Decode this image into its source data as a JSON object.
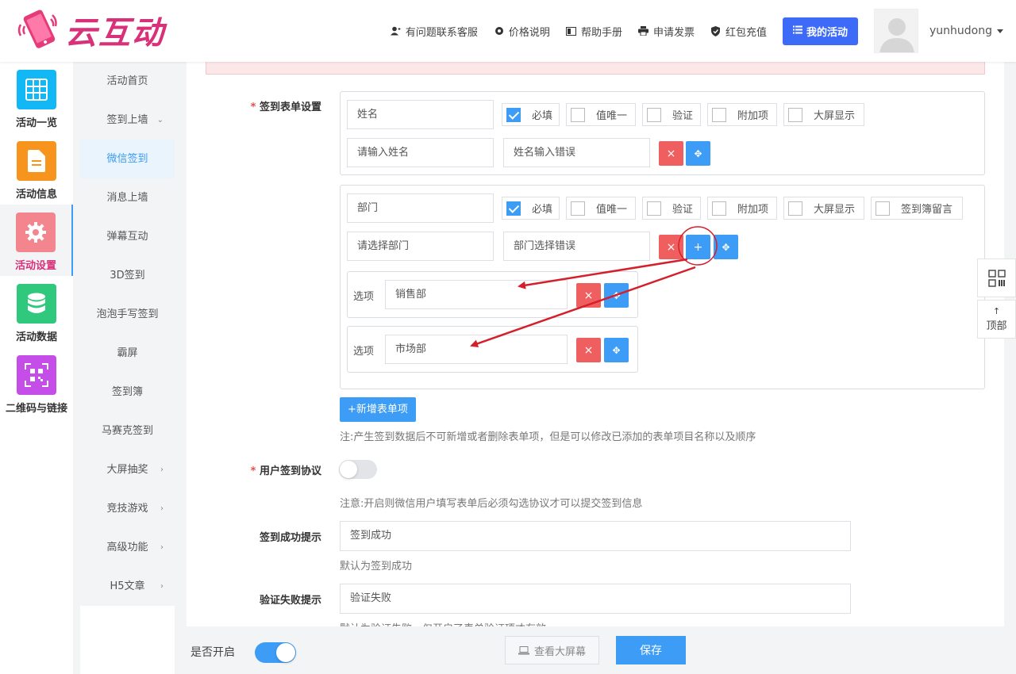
{
  "brand": {
    "name": "云互动",
    "color": "#d9307a"
  },
  "nav": {
    "support": "有问题联系客服",
    "pricing": "价格说明",
    "manual": "帮助手册",
    "invoice": "申请发票",
    "redpack": "红包充值",
    "my_activity": "我的活动",
    "username": "yunhudong"
  },
  "icon_sidebar": [
    {
      "label": "活动一览",
      "icon": "grid-icon",
      "color": "#12b7f5"
    },
    {
      "label": "活动信息",
      "icon": "document-icon",
      "color": "#f7941d"
    },
    {
      "label": "活动设置",
      "icon": "gear-icon",
      "color": "#f3858f"
    },
    {
      "label": "活动数据",
      "icon": "database-icon",
      "color": "#2fc87d"
    },
    {
      "label": "二维码与链接",
      "icon": "qrcode-icon",
      "color": "#c64ee8"
    }
  ],
  "sub_sidebar": [
    {
      "label": "活动首页",
      "arrow": ""
    },
    {
      "label": "签到上墙",
      "arrow": "⌄"
    },
    {
      "label": "微信签到",
      "arrow": ""
    },
    {
      "label": "消息上墙",
      "arrow": ""
    },
    {
      "label": "弹幕互动",
      "arrow": ""
    },
    {
      "label": "3D签到",
      "arrow": ""
    },
    {
      "label": "泡泡手写签到",
      "arrow": ""
    },
    {
      "label": "霸屏",
      "arrow": ""
    },
    {
      "label": "签到簿",
      "arrow": ""
    },
    {
      "label": "马赛克签到",
      "arrow": ""
    },
    {
      "label": "大屏抽奖",
      "arrow": "›"
    },
    {
      "label": "竞技游戏",
      "arrow": "›"
    },
    {
      "label": "高级功能",
      "arrow": "›"
    },
    {
      "label": "H5文章",
      "arrow": "›"
    }
  ],
  "form": {
    "signin_form_label": "签到表单设置",
    "req_mark": "* ",
    "field1": {
      "name": "姓名",
      "placeholder": "请输入姓名",
      "error": "姓名输入错误",
      "options": [
        "必填",
        "值唯一",
        "验证",
        "附加项",
        "大屏显示"
      ]
    },
    "field2": {
      "name": "部门",
      "placeholder": "请选择部门",
      "error": "部门选择错误",
      "options": [
        "必填",
        "值唯一",
        "验证",
        "附加项",
        "大屏显示",
        "签到簿留言"
      ],
      "choice_label": "选项",
      "choices": [
        "销售部",
        "市场部"
      ]
    },
    "add_field_btn": "+新增表单项",
    "add_field_note": "注:产生签到数据后不可新增或者删除表单项，但是可以修改已添加的表单项目名称以及顺序",
    "agreement_label": "用户签到协议",
    "agreement_note": "注意:开启则微信用户填写表单后必须勾选协议才可以提交签到信息",
    "success_label": "签到成功提示",
    "success_value": "签到成功",
    "success_note": "默认为签到成功",
    "fail_label": "验证失败提示",
    "fail_value": "验证失败",
    "fail_note": "默认为验证失败，仅开启了表单验证项才有效"
  },
  "bottom": {
    "enable_label": "是否开启",
    "view_screen": "查看大屏幕",
    "save": "保存"
  },
  "float": {
    "top_label": "顶部",
    "top_arrow": "↑"
  },
  "buttons": {
    "del": "×",
    "add": "+",
    "move": "✥"
  }
}
